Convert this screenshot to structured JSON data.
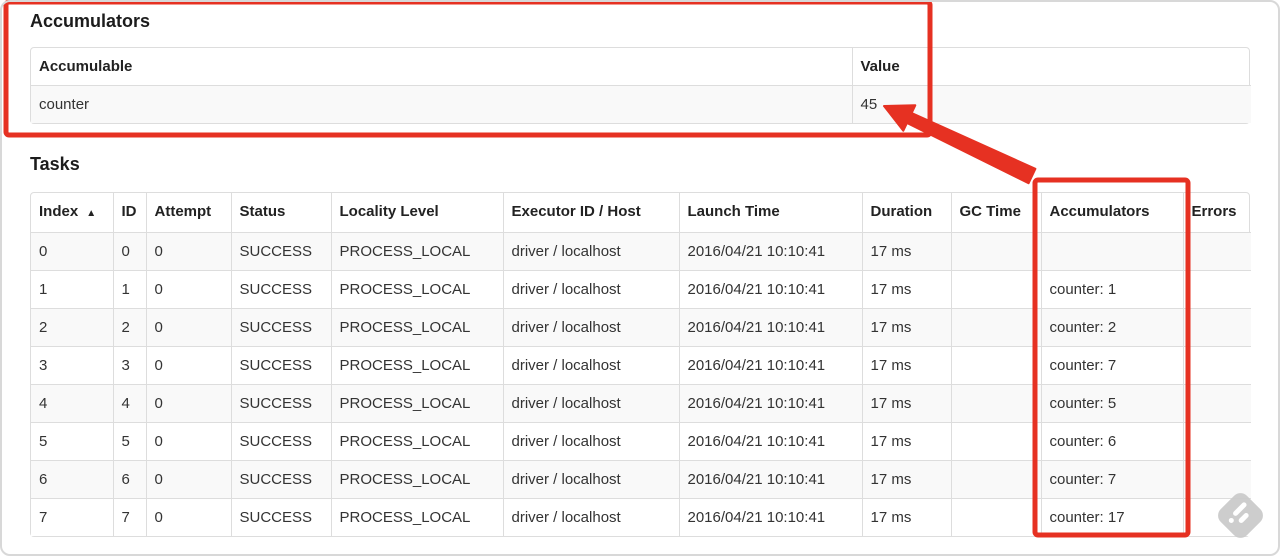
{
  "theme": {
    "annotation_red": "#e63122",
    "table_border": "#dddddd",
    "row_stripe": "#f9f9f9"
  },
  "accumulators": {
    "title": "Accumulators",
    "table": {
      "headers": [
        "Accumulable",
        "Value"
      ],
      "rows": [
        [
          "counter",
          "45"
        ]
      ]
    }
  },
  "tasks": {
    "title": "Tasks",
    "table": {
      "headers": [
        "Index",
        "ID",
        "Attempt",
        "Status",
        "Locality Level",
        "Executor ID / Host",
        "Launch Time",
        "Duration",
        "GC Time",
        "Accumulators",
        "Errors"
      ],
      "sort_icon": "▲",
      "rows": [
        {
          "index": "0",
          "id": "0",
          "attempt": "0",
          "status": "SUCCESS",
          "locality": "PROCESS_LOCAL",
          "executor": "driver / localhost",
          "launch": "2016/04/21 10:10:41",
          "duration": "17 ms",
          "gc_time": "",
          "accumulators": "",
          "errors": ""
        },
        {
          "index": "1",
          "id": "1",
          "attempt": "0",
          "status": "SUCCESS",
          "locality": "PROCESS_LOCAL",
          "executor": "driver / localhost",
          "launch": "2016/04/21 10:10:41",
          "duration": "17 ms",
          "gc_time": "",
          "accumulators": "counter: 1",
          "errors": ""
        },
        {
          "index": "2",
          "id": "2",
          "attempt": "0",
          "status": "SUCCESS",
          "locality": "PROCESS_LOCAL",
          "executor": "driver / localhost",
          "launch": "2016/04/21 10:10:41",
          "duration": "17 ms",
          "gc_time": "",
          "accumulators": "counter: 2",
          "errors": ""
        },
        {
          "index": "3",
          "id": "3",
          "attempt": "0",
          "status": "SUCCESS",
          "locality": "PROCESS_LOCAL",
          "executor": "driver / localhost",
          "launch": "2016/04/21 10:10:41",
          "duration": "17 ms",
          "gc_time": "",
          "accumulators": "counter: 7",
          "errors": ""
        },
        {
          "index": "4",
          "id": "4",
          "attempt": "0",
          "status": "SUCCESS",
          "locality": "PROCESS_LOCAL",
          "executor": "driver / localhost",
          "launch": "2016/04/21 10:10:41",
          "duration": "17 ms",
          "gc_time": "",
          "accumulators": "counter: 5",
          "errors": ""
        },
        {
          "index": "5",
          "id": "5",
          "attempt": "0",
          "status": "SUCCESS",
          "locality": "PROCESS_LOCAL",
          "executor": "driver / localhost",
          "launch": "2016/04/21 10:10:41",
          "duration": "17 ms",
          "gc_time": "",
          "accumulators": "counter: 6",
          "errors": ""
        },
        {
          "index": "6",
          "id": "6",
          "attempt": "0",
          "status": "SUCCESS",
          "locality": "PROCESS_LOCAL",
          "executor": "driver / localhost",
          "launch": "2016/04/21 10:10:41",
          "duration": "17 ms",
          "gc_time": "",
          "accumulators": "counter: 7",
          "errors": ""
        },
        {
          "index": "7",
          "id": "7",
          "attempt": "0",
          "status": "SUCCESS",
          "locality": "PROCESS_LOCAL",
          "executor": "driver / localhost",
          "launch": "2016/04/21 10:10:41",
          "duration": "17 ms",
          "gc_time": "",
          "accumulators": "counter: 17",
          "errors": ""
        }
      ]
    }
  }
}
